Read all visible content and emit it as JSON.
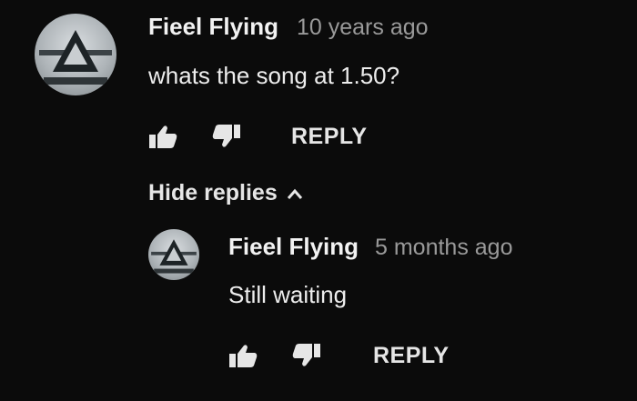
{
  "comment": {
    "author": "Fieel Flying",
    "time": "10 years ago",
    "text": "whats the song at 1.50?",
    "reply_label": "REPLY"
  },
  "hide_replies_label": "Hide replies",
  "reply": {
    "author": "Fieel Flying",
    "time": "5 months ago",
    "text": "Still waiting",
    "reply_label": "REPLY"
  },
  "icons": {
    "like": "thumbs-up-icon",
    "dislike": "thumbs-down-icon",
    "toggle": "chevron-up-icon"
  },
  "colors": {
    "background": "#0b0b0b",
    "text": "#ededed",
    "muted": "#9a9a9a"
  }
}
